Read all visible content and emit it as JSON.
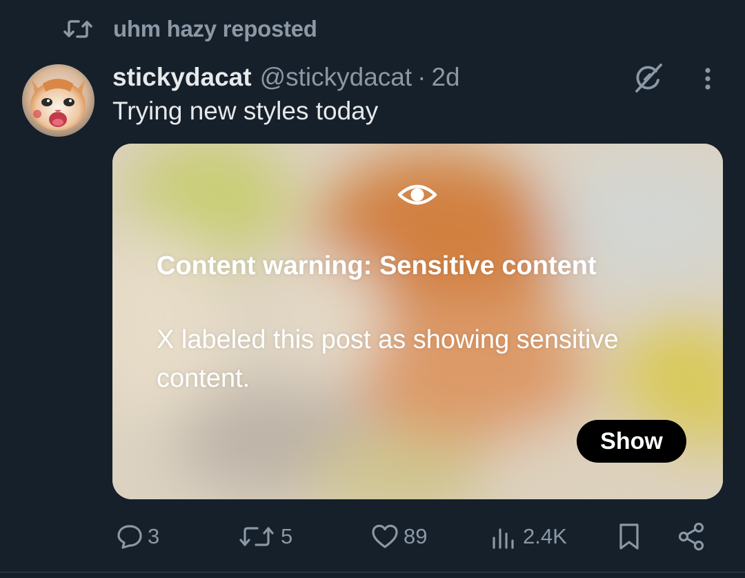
{
  "repost": {
    "label": "uhm hazy reposted",
    "icon": "repost-icon"
  },
  "post": {
    "display_name": "stickydacat",
    "handle": "@stickydacat",
    "separator": "·",
    "age": "2d",
    "text": "Trying new styles today",
    "avatar": "kitten-avatar"
  },
  "media": {
    "icon": "eye-icon",
    "warning_title": "Content warning: Sensitive content",
    "warning_body": "X labeled this post as showing sensitive content.",
    "show_label": "Show"
  },
  "actions": {
    "replies": "3",
    "reposts": "5",
    "likes": "89",
    "views": "2.4K"
  },
  "colors": {
    "background": "#15202b",
    "text_primary": "#e7e9ea",
    "text_secondary": "#8b98a5",
    "button_bg": "#000000"
  }
}
